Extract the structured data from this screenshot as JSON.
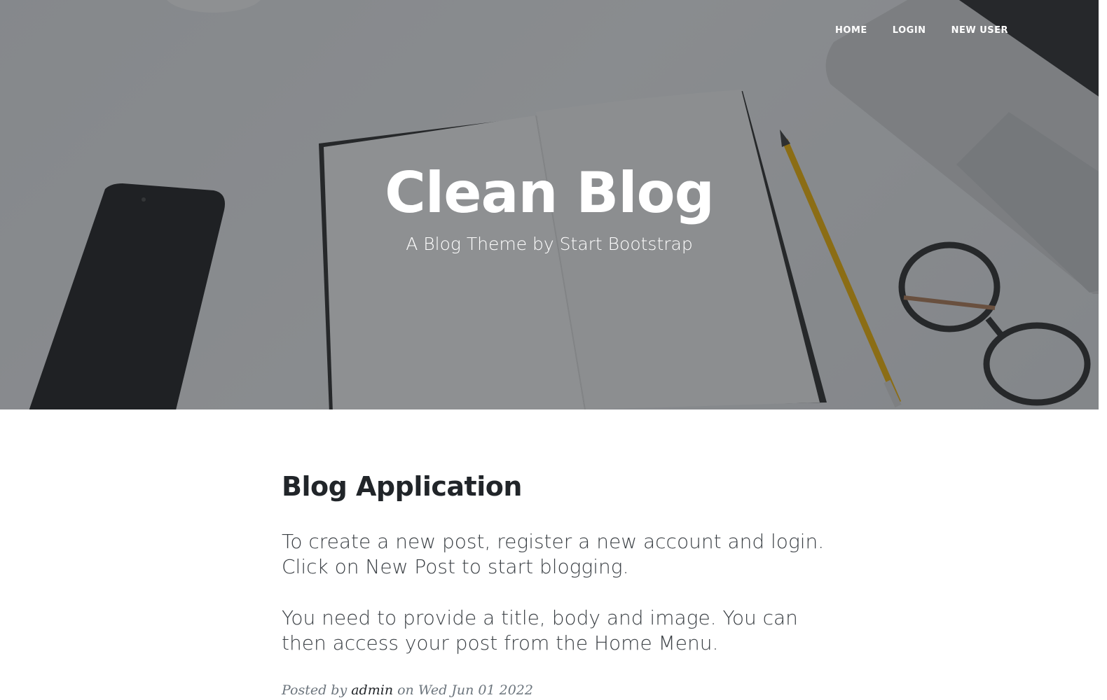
{
  "nav": {
    "items": [
      {
        "label": "HOME"
      },
      {
        "label": "LOGIN"
      },
      {
        "label": "NEW USER"
      }
    ]
  },
  "hero": {
    "title": "Clean Blog",
    "subheading": "A Blog Theme by Start Bootstrap"
  },
  "post": {
    "title": "Blog Application",
    "paragraphs": [
      "To create a new post, register a new account and login. Click on New Post to start blogging.",
      "You need to provide a title, body and image. You can then access your post from the Home Menu."
    ],
    "meta_prefix": "Posted by",
    "author": "admin",
    "meta_on": "on",
    "date": "Wed Jun 01 2022"
  },
  "colors": {
    "overlay": "#212529",
    "text": "#212529",
    "meta": "#6c757d"
  }
}
